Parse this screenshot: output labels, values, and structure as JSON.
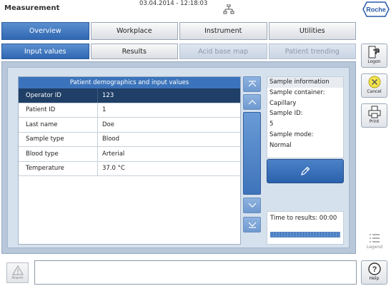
{
  "header": {
    "title": "Measurement",
    "datetime": "03.04.2014 - 12:18:03",
    "network_icon": "network-icon",
    "brand": "Roche"
  },
  "main_tabs": [
    {
      "label": "Overview",
      "state": "active"
    },
    {
      "label": "Workplace",
      "state": "normal"
    },
    {
      "label": "Instrument",
      "state": "normal"
    },
    {
      "label": "Utilities",
      "state": "normal"
    }
  ],
  "sub_tabs": [
    {
      "label": "Input values",
      "state": "active"
    },
    {
      "label": "Results",
      "state": "normal"
    },
    {
      "label": "Acid base map",
      "state": "disabled"
    },
    {
      "label": "Patient trending",
      "state": "disabled"
    }
  ],
  "table": {
    "title": "Patient demographics and input values",
    "rows": [
      {
        "label": "Operator ID",
        "value": "123",
        "selected": true
      },
      {
        "label": "Patient ID",
        "value": "1"
      },
      {
        "label": "Last name",
        "value": "Doe"
      },
      {
        "label": "Sample type",
        "value": "Blood"
      },
      {
        "label": "Blood type",
        "value": "Arterial"
      },
      {
        "label": "Temperature",
        "value": "37.0 °C"
      }
    ]
  },
  "scroll_buttons": [
    "scroll-top-icon",
    "scroll-up-icon",
    "scroll-down-icon",
    "scroll-bottom-icon"
  ],
  "sample_info": {
    "header": "Sample information",
    "container_label": "Sample container:",
    "container_value": "Capillary",
    "id_label": "Sample ID:",
    "id_value": "5",
    "mode_label": "Sample mode:",
    "mode_value": "Normal"
  },
  "edit_button_icon": "pencil-icon",
  "time_to_results": {
    "label": "Time to results:",
    "value": "00:00",
    "progress": 1.0
  },
  "side_buttons": {
    "logon": "Logon",
    "cancel": "Cancel",
    "print": "Print",
    "legend": "Legend",
    "help": "Help"
  },
  "alarm": {
    "label": "Alarm",
    "icon": "warning-icon"
  },
  "colors": {
    "accent": "#3c74bb",
    "selected_row": "#1f3f66",
    "panel": "#b8c7da"
  }
}
